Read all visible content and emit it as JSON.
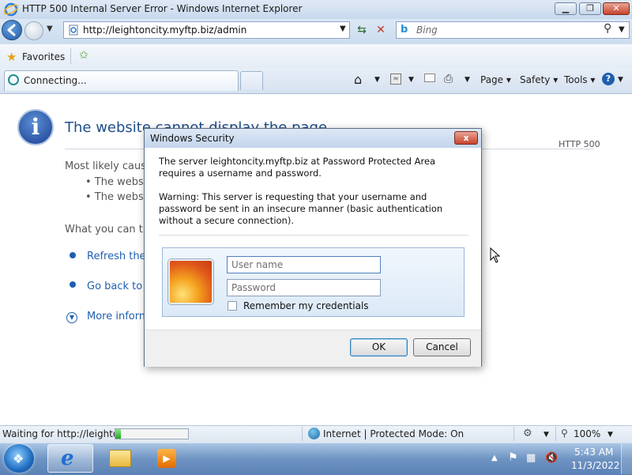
{
  "window": {
    "title": "HTTP 500 Internal Server Error - Windows Internet Explorer"
  },
  "navigation": {
    "address": "http://leightoncity.myftp.biz/admin",
    "search_placeholder": "Bing"
  },
  "favorites_bar": {
    "favorites_label": "Favorites"
  },
  "tab": {
    "label": "Connecting..."
  },
  "command_bar": {
    "page": "Page ▾",
    "safety": "Safety ▾",
    "tools": "Tools ▾",
    "help": "?"
  },
  "content": {
    "heading": "The website cannot display the page",
    "http_code": "HTTP 500",
    "likely_causes": "Most likely causes:",
    "causes": [
      "• The website is undergoing maintenance.",
      "• The website has a programming error."
    ],
    "what_you_can_try": "What you can try:",
    "refresh_link": "Refresh the page.",
    "go_back_link": "Go back to the previous page.",
    "more_info_link": "More information"
  },
  "dialog": {
    "title": "Windows Security",
    "close_label": "x",
    "message": "The server leightoncity.myftp.biz at Password Protected Area requires a username and password.",
    "warning": "Warning: This server is requesting that your username and password be sent in an insecure manner (basic authentication without a secure connection).",
    "username_placeholder": "User name",
    "password_placeholder": "Password",
    "remember_label": "Remember my credentials",
    "ok_label": "OK",
    "cancel_label": "Cancel"
  },
  "statusbar": {
    "status_text": "Waiting for http://leightor",
    "progress": 0.08,
    "zone_text": "Internet | Protected Mode: On",
    "zoom": "100%"
  },
  "taskbar": {
    "time": "5:43 AM",
    "date": "11/3/2022"
  },
  "colors": {
    "link": "#1f5fb0",
    "heading": "#1f4e8a",
    "close_button": "#c8432c",
    "progress": "#22a522"
  },
  "icons": {
    "app": "ie-icon",
    "info": "info-icon",
    "user_tile": "flower-picture-icon",
    "zone": "globe-icon",
    "start": "windows-logo-icon"
  }
}
